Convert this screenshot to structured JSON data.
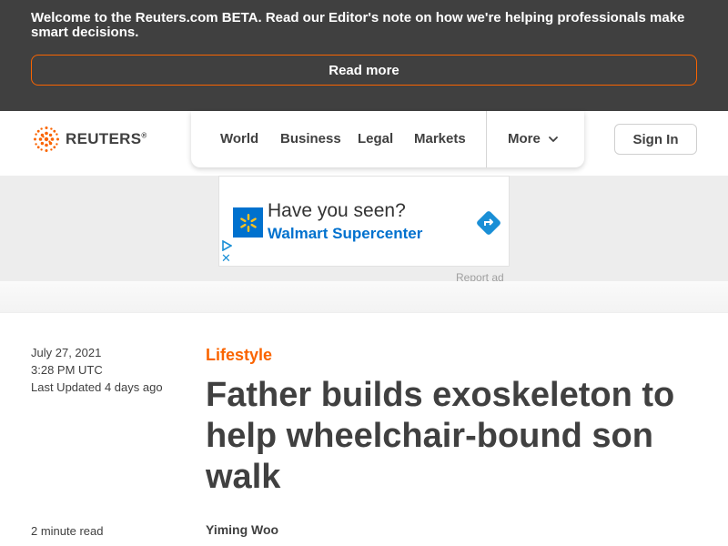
{
  "banner": {
    "message": "Welcome to the Reuters.com BETA. Read our Editor's note on how we're helping professionals make smart decisions.",
    "read_more_label": "Read more"
  },
  "header": {
    "logo_text": "REUTERS",
    "logo_mark": "®",
    "nav": [
      "World",
      "Business",
      "Legal",
      "Markets"
    ],
    "more_label": "More",
    "sign_in_label": "Sign In"
  },
  "ad": {
    "headline": "Have you seen?",
    "advertiser": "Walmart Supercenter",
    "report_label": "Report ad",
    "brand_color": "#0071ce"
  },
  "article": {
    "date": "July 27, 2021",
    "time": "3:28 PM UTC",
    "last_updated": "Last Updated 4 days ago",
    "read_time": "2 minute read",
    "category": "Lifestyle",
    "headline": "Father builds exoskeleton to help wheelchair-bound son walk",
    "author": "Yiming Woo"
  },
  "colors": {
    "accent": "#fa6400",
    "banner_bg": "#404040",
    "text": "#404040"
  }
}
